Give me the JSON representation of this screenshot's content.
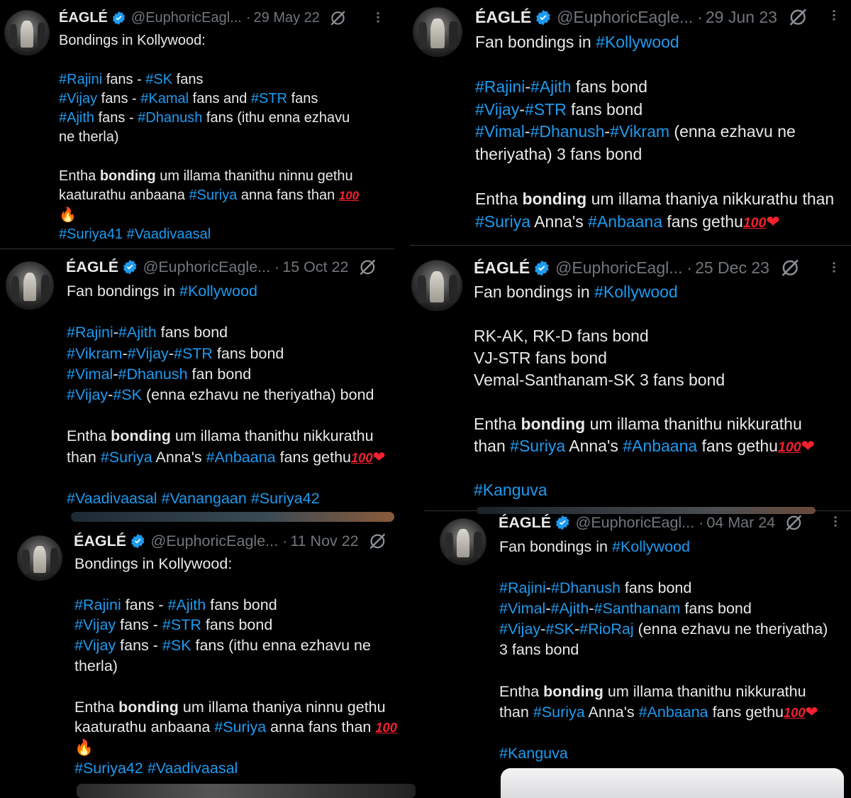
{
  "tweets": [
    {
      "name": "ÉAGLÉ",
      "handle": "@EuphoricEagl...",
      "date": "29 May 22",
      "lines": [
        [
          [
            "t",
            "Bondings in Kollywood:"
          ]
        ],
        [],
        [
          [
            "h",
            "#Rajini"
          ],
          [
            "t",
            " fans - "
          ],
          [
            "h",
            "#SK"
          ],
          [
            "t",
            " fans"
          ]
        ],
        [
          [
            "h",
            "#Vijay"
          ],
          [
            "t",
            " fans - "
          ],
          [
            "h",
            "#Kamal"
          ],
          [
            "t",
            " fans and "
          ],
          [
            "h",
            "#STR"
          ],
          [
            "t",
            " fans"
          ]
        ],
        [
          [
            "h",
            "#Ajith"
          ],
          [
            "t",
            " fans - "
          ],
          [
            "h",
            "#Dhanush"
          ],
          [
            "t",
            " fans (ithu enna ezhavu"
          ]
        ],
        [
          [
            "t",
            "ne therla)"
          ]
        ],
        [],
        [
          [
            "t",
            "Entha "
          ],
          [
            "b",
            "bonding"
          ],
          [
            "t",
            " um illama thanithu ninnu gethu"
          ]
        ],
        [
          [
            "t",
            "kaaturathu anbaana "
          ],
          [
            "h",
            "#Suriya"
          ],
          [
            "t",
            " anna fans than "
          ],
          [
            "e100",
            "100"
          ]
        ],
        [
          [
            "efire",
            "🔥"
          ]
        ],
        [
          [
            "h",
            "#Suriya41"
          ],
          [
            "t",
            " "
          ],
          [
            "h",
            "#Vaadivaasal"
          ]
        ]
      ]
    },
    {
      "name": "ÉAGLÉ",
      "handle": "@EuphoricEagle...",
      "date": "29 Jun 23",
      "lines": [
        [
          [
            "t",
            "Fan bondings in "
          ],
          [
            "h",
            "#Kollywood"
          ]
        ],
        [],
        [
          [
            "h",
            "#Rajini"
          ],
          [
            "t",
            "-"
          ],
          [
            "h",
            "#Ajith"
          ],
          [
            "t",
            " fans bond"
          ]
        ],
        [
          [
            "h",
            "#Vijay"
          ],
          [
            "t",
            "-"
          ],
          [
            "h",
            "#STR"
          ],
          [
            "t",
            " fans bond"
          ]
        ],
        [
          [
            "h",
            "#Vimal"
          ],
          [
            "t",
            "-"
          ],
          [
            "h",
            "#Dhanush"
          ],
          [
            "t",
            "-"
          ],
          [
            "h",
            "#Vikram"
          ],
          [
            "t",
            " (enna ezhavu ne"
          ]
        ],
        [
          [
            "t",
            "theriyatha) 3 fans bond"
          ]
        ],
        [],
        [
          [
            "t",
            "Entha "
          ],
          [
            "b",
            "bonding"
          ],
          [
            "t",
            " um illama thaniya nikkurathu than"
          ]
        ],
        [
          [
            "h",
            "#Suriya"
          ],
          [
            "t",
            " Anna's "
          ],
          [
            "h",
            "#Anbaana"
          ],
          [
            "t",
            " fans gethu"
          ],
          [
            "e100",
            "100"
          ],
          [
            "eheart",
            "❤"
          ]
        ]
      ]
    },
    {
      "name": "ÉAGLÉ",
      "handle": "@EuphoricEagle...",
      "date": "15 Oct 22",
      "lines": [
        [
          [
            "t",
            "Fan bondings in "
          ],
          [
            "h",
            "#Kollywood"
          ]
        ],
        [],
        [
          [
            "h",
            "#Rajini"
          ],
          [
            "t",
            "-"
          ],
          [
            "h",
            "#Ajith"
          ],
          [
            "t",
            " fans bond"
          ]
        ],
        [
          [
            "h",
            "#Vikram"
          ],
          [
            "t",
            "-"
          ],
          [
            "h",
            "#Vijay"
          ],
          [
            "t",
            "-"
          ],
          [
            "h",
            "#STR"
          ],
          [
            "t",
            " fans bond"
          ]
        ],
        [
          [
            "h",
            "#Vimal"
          ],
          [
            "t",
            "-"
          ],
          [
            "h",
            "#Dhanush"
          ],
          [
            "t",
            " fan bond"
          ]
        ],
        [
          [
            "h",
            "#Vijay"
          ],
          [
            "t",
            "-"
          ],
          [
            "h",
            "#SK"
          ],
          [
            "t",
            " (enna ezhavu ne theriyatha) bond"
          ]
        ],
        [],
        [
          [
            "t",
            "Entha "
          ],
          [
            "b",
            "bonding"
          ],
          [
            "t",
            " um illama thanithu nikkurathu"
          ]
        ],
        [
          [
            "t",
            "than "
          ],
          [
            "h",
            "#Suriya"
          ],
          [
            "t",
            " Anna's "
          ],
          [
            "h",
            "#Anbaana"
          ],
          [
            "t",
            " fans gethu"
          ],
          [
            "e100",
            "100"
          ],
          [
            "eheart",
            "❤"
          ]
        ],
        [],
        [
          [
            "h",
            "#Vaadivaasal"
          ],
          [
            "t",
            " "
          ],
          [
            "h",
            "#Vanangaan"
          ],
          [
            "t",
            " "
          ],
          [
            "h",
            "#Suriya42"
          ]
        ]
      ]
    },
    {
      "name": "ÉAGLÉ",
      "handle": "@EuphoricEagl...",
      "date": "25 Dec 23",
      "lines": [
        [
          [
            "t",
            "Fan bondings in "
          ],
          [
            "h",
            "#Kollywood"
          ]
        ],
        [],
        [
          [
            "t",
            "RK-AK, RK-D fans bond"
          ]
        ],
        [
          [
            "t",
            "VJ-STR fans bond"
          ]
        ],
        [
          [
            "t",
            "Vemal-Santhanam-SK 3 fans bond"
          ]
        ],
        [],
        [
          [
            "t",
            "Entha "
          ],
          [
            "b",
            "bonding"
          ],
          [
            "t",
            " um illama thanithu nikkurathu"
          ]
        ],
        [
          [
            "t",
            "than "
          ],
          [
            "h",
            "#Suriya"
          ],
          [
            "t",
            " Anna's "
          ],
          [
            "h",
            "#Anbaana"
          ],
          [
            "t",
            " fans gethu"
          ],
          [
            "e100",
            "100"
          ],
          [
            "eheart",
            "❤"
          ]
        ],
        [],
        [
          [
            "h",
            "#Kanguva"
          ]
        ]
      ]
    },
    {
      "name": "ÉAGLÉ",
      "handle": "@EuphoricEagle...",
      "date": "11 Nov 22",
      "lines": [
        [
          [
            "t",
            "Bondings in Kollywood:"
          ]
        ],
        [],
        [
          [
            "h",
            "#Rajini"
          ],
          [
            "t",
            " fans - "
          ],
          [
            "h",
            "#Ajith"
          ],
          [
            "t",
            " fans bond"
          ]
        ],
        [
          [
            "h",
            "#Vijay"
          ],
          [
            "t",
            " fans - "
          ],
          [
            "h",
            "#STR"
          ],
          [
            "t",
            " fans bond"
          ]
        ],
        [
          [
            "h",
            "#Vijay"
          ],
          [
            "t",
            " fans - "
          ],
          [
            "h",
            "#SK"
          ],
          [
            "t",
            " fans (ithu enna ezhavu ne"
          ]
        ],
        [
          [
            "t",
            "therla)"
          ]
        ],
        [],
        [
          [
            "t",
            "Entha "
          ],
          [
            "b",
            "bonding"
          ],
          [
            "t",
            " um illama thaniya ninnu gethu"
          ]
        ],
        [
          [
            "t",
            "kaaturathu anbaana "
          ],
          [
            "h",
            "#Suriya"
          ],
          [
            "t",
            " anna fans than "
          ],
          [
            "e100",
            "100"
          ]
        ],
        [
          [
            "efire",
            "🔥"
          ]
        ],
        [
          [
            "h",
            "#Suriya42"
          ],
          [
            "t",
            " "
          ],
          [
            "h",
            "#Vaadivaasal"
          ]
        ]
      ]
    },
    {
      "name": "ÉAGLÉ",
      "handle": "@EuphoricEagl...",
      "date": "04 Mar 24",
      "lines": [
        [
          [
            "t",
            "Fan bondings in "
          ],
          [
            "h",
            "#Kollywood"
          ]
        ],
        [],
        [
          [
            "h",
            "#Rajini"
          ],
          [
            "t",
            "-"
          ],
          [
            "h",
            "#Dhanush"
          ],
          [
            "t",
            " fans bond"
          ]
        ],
        [
          [
            "h",
            "#Vimal"
          ],
          [
            "t",
            "-"
          ],
          [
            "h",
            "#Ajith"
          ],
          [
            "t",
            "-"
          ],
          [
            "h",
            "#Santhanam"
          ],
          [
            "t",
            " fans bond"
          ]
        ],
        [
          [
            "h",
            "#Vijay"
          ],
          [
            "t",
            "-"
          ],
          [
            "h",
            "#SK"
          ],
          [
            "t",
            "-"
          ],
          [
            "h",
            "#RioRaj"
          ],
          [
            "t",
            " (enna ezhavu ne theriyatha)"
          ]
        ],
        [
          [
            "t",
            "3 fans bond"
          ]
        ],
        [],
        [
          [
            "t",
            "Entha "
          ],
          [
            "b",
            "bonding"
          ],
          [
            "t",
            " um illama thanithu nikkurathu"
          ]
        ],
        [
          [
            "t",
            "than "
          ],
          [
            "h",
            "#Suriya"
          ],
          [
            "t",
            " Anna's "
          ],
          [
            "h",
            "#Anbaana"
          ],
          [
            "t",
            " fans gethu"
          ],
          [
            "e100",
            "100"
          ],
          [
            "eheart",
            "❤"
          ]
        ],
        [],
        [
          [
            "h",
            "#Kanguva"
          ]
        ]
      ]
    }
  ],
  "colors": {
    "hashtag": "#1d9bf0",
    "muted": "#71767b",
    "text": "#e7e9ea",
    "background": "#000000",
    "verified": "#1d9bf0"
  },
  "icons": {
    "verified": "verified-badge-icon",
    "grok": "grok-icon",
    "more": "more-dots-icon"
  }
}
